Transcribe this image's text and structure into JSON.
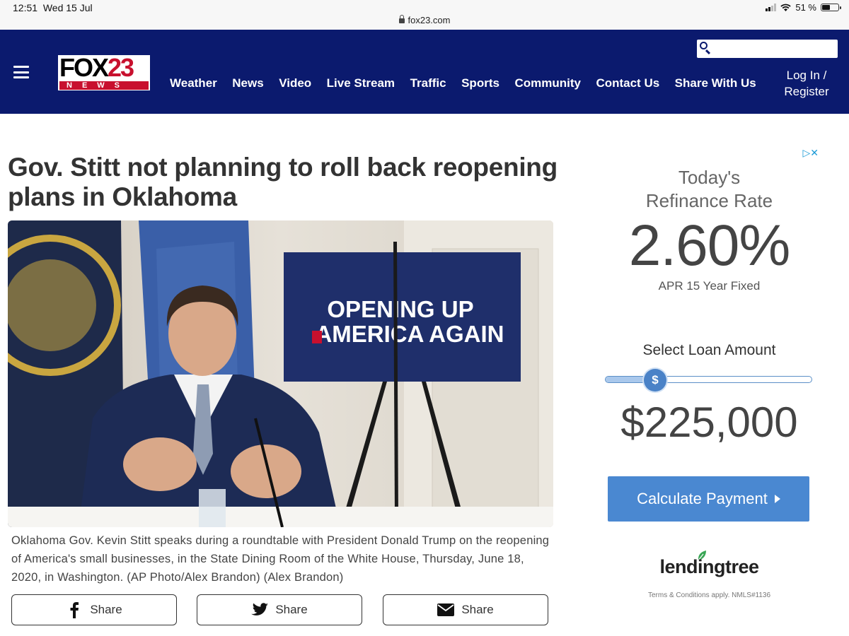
{
  "status_bar": {
    "time": "12:51",
    "date": "Wed 15 Jul",
    "battery": "51 %",
    "url": "fox23.com"
  },
  "header": {
    "logo_fox": "FOX",
    "logo_number": "23",
    "logo_news": "NEWS",
    "nav": [
      "Weather",
      "News",
      "Video",
      "Live Stream",
      "Traffic",
      "Sports",
      "Community",
      "Contact Us",
      "Share With Us"
    ],
    "search_placeholder": "",
    "login_line1": "Log In /",
    "login_line2": "Register",
    "colors": {
      "background": "#0b1a6e",
      "logo_red": "#c8102e"
    }
  },
  "article": {
    "headline": "Gov. Stitt not planning to roll back reopening plans in Oklahoma",
    "photo": {
      "sign_line1": "OPENING UP",
      "sign_line2": "AMERICA AGAIN"
    },
    "caption": "Oklahoma Gov. Kevin Stitt speaks during a roundtable with President Donald Trump on the reopening of America's small businesses, in the State Dining Room of the White House, Thursday, June 18, 2020, in Washington. (AP Photo/Alex Brandon) (Alex Brandon)",
    "share_buttons": [
      {
        "label": "Share",
        "icon": "facebook-icon"
      },
      {
        "label": "Share",
        "icon": "twitter-icon"
      },
      {
        "label": "Share",
        "icon": "email-icon"
      }
    ]
  },
  "ad": {
    "title_line1": "Today's",
    "title_line2": "Refinance Rate",
    "rate": "2.60%",
    "apr_label": "APR 15 Year Fixed",
    "select_label": "Select Loan Amount",
    "slider_symbol": "$",
    "slider_fraction": 0.24,
    "amount": "$225,000",
    "cta_label": "Calculate Payment",
    "brand": "lendingtree",
    "terms": "Terms & Conditions apply. NMLS#1136",
    "colors": {
      "accent": "#4a88d1",
      "leaf": "#3aa655"
    }
  }
}
